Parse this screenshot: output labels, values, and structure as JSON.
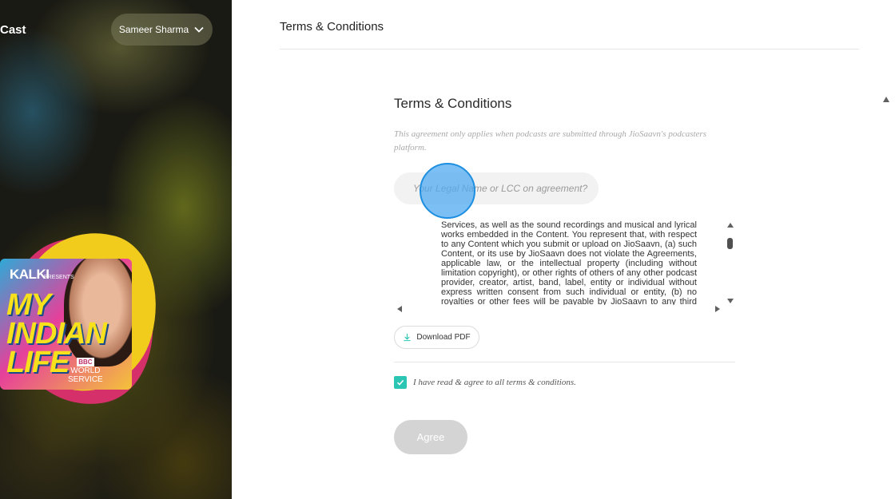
{
  "brand": {
    "name": "Cast"
  },
  "user_menu": {
    "name": "Sameer Sharma",
    "icon": "chevron-down-icon"
  },
  "podcast_art": {
    "kalki": "KALKI",
    "presents": "PRESENTS",
    "title": "MY INDIAN LIFE",
    "bbc": "BBC",
    "world": "WORLD",
    "service": "SERVICE"
  },
  "header": {
    "title": "Terms & Conditions"
  },
  "terms": {
    "section_title": "Terms & Conditions",
    "note": "This agreement only applies when podcasts are submitted through JioSaavn's podcasters platform.",
    "legal_name_placeholder": "Your Legal Name or LCC on agreement?",
    "body": "Services, as well as the sound recordings and musical and lyrical works embedded in the Content. You represent that, with respect to any Content which you submit or upload on JioSaavn, (a) such Content, or its use by JioSaavn does not violate the Agreements, applicable law, or the intellectual property (including without limitation copyright), or other rights of others of any other podcast provider, creator, artist, band, label, entity or individual without express written consent from such individual or entity, (b) no royalties or other fees will be payable by JioSaavn to any third party",
    "download_label": "Download PDF",
    "agree_checkbox_label": "I have read & agree to all terms & conditions.",
    "agree_checked": true,
    "agree_button": "Agree"
  },
  "colors": {
    "accent": "#2bc5b4",
    "disabled_button": "#d4d4d4",
    "click_indicator": "#1e8fe0"
  }
}
